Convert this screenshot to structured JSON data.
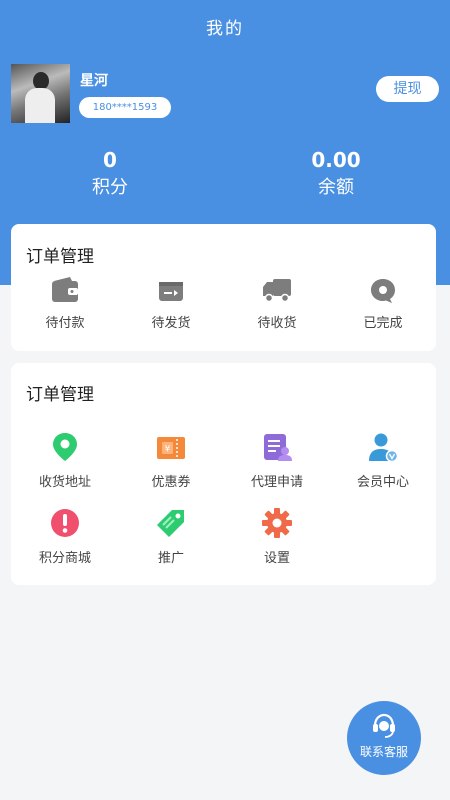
{
  "header": {
    "title": "我的"
  },
  "profile": {
    "name": "星河",
    "phone": "180****1593",
    "withdraw_label": "提现"
  },
  "stats": {
    "points": {
      "value": "0",
      "label": "积分"
    },
    "balance": {
      "value": "0.00",
      "label": "余额"
    }
  },
  "orders": {
    "title": "订单管理",
    "items": [
      {
        "label": "待付款",
        "icon": "wallet-icon"
      },
      {
        "label": "待发货",
        "icon": "package-icon"
      },
      {
        "label": "待收货",
        "icon": "truck-icon"
      },
      {
        "label": "已完成",
        "icon": "chat-bubble-icon"
      }
    ]
  },
  "services": {
    "title": "订单管理",
    "items": [
      {
        "label": "收货地址",
        "icon": "location-pin-icon",
        "color": "#2ecc71"
      },
      {
        "label": "优惠券",
        "icon": "coupon-icon",
        "color": "#f5893a"
      },
      {
        "label": "代理申请",
        "icon": "agent-apply-icon",
        "color": "#8e6bd8"
      },
      {
        "label": "会员中心",
        "icon": "member-icon",
        "color": "#3a9ad9"
      },
      {
        "label": "积分商城",
        "icon": "exclamation-icon",
        "color": "#f0506e"
      },
      {
        "label": "推广",
        "icon": "tag-icon",
        "color": "#2ecc71"
      },
      {
        "label": "设置",
        "icon": "gear-icon",
        "color": "#f06a4a"
      }
    ]
  },
  "support": {
    "label": "联系客服",
    "icon": "headset-icon"
  },
  "colors": {
    "primary": "#4a90e2",
    "background": "#f4f5f7",
    "order_icon": "#7d7d7d"
  }
}
